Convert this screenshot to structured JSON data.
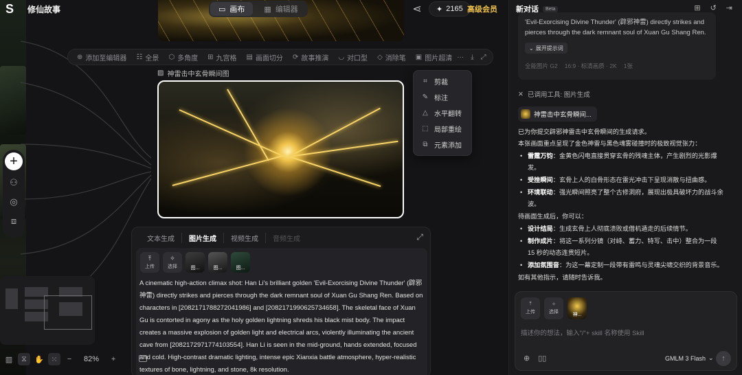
{
  "app": {
    "logo": "S",
    "project_title": "修仙故事"
  },
  "view_tabs": [
    {
      "label": "画布",
      "icon": "canvas-icon",
      "active": true
    },
    {
      "label": "编辑器",
      "icon": "editor-icon",
      "active": false
    }
  ],
  "topbar": {
    "credits": "2165",
    "vip_label": "高级会员"
  },
  "toolbar": [
    {
      "label": "添加至编辑器",
      "icon": "add-circle-icon"
    },
    {
      "label": "全景",
      "icon": "panorama-icon"
    },
    {
      "label": "多角度",
      "icon": "cube-icon"
    },
    {
      "label": "九宫格",
      "icon": "grid-icon"
    },
    {
      "label": "画面切分",
      "icon": "split-icon"
    },
    {
      "label": "故事推演",
      "icon": "story-icon"
    },
    {
      "label": "对口型",
      "icon": "lipsync-icon"
    },
    {
      "label": "消除笔",
      "icon": "eraser-icon"
    },
    {
      "label": "图片超清",
      "icon": "hd-icon"
    }
  ],
  "image_caption": "神雷击中玄骨瞬间图",
  "context_menu": [
    {
      "label": "剪裁",
      "icon": "crop-icon"
    },
    {
      "label": "标注",
      "icon": "annotate-icon"
    },
    {
      "label": "水平翻转",
      "icon": "flip-icon"
    },
    {
      "label": "局部重绘",
      "icon": "repaint-icon"
    },
    {
      "label": "元素添加",
      "icon": "element-add-icon"
    }
  ],
  "zoom": "82%",
  "gen_panel": {
    "tabs": [
      {
        "label": "文本生成",
        "state": "normal"
      },
      {
        "label": "图片生成",
        "state": "active"
      },
      {
        "label": "视频生成",
        "state": "normal"
      },
      {
        "label": "音频生成",
        "state": "disabled"
      }
    ],
    "upload_label": "上传",
    "select_label": "选择",
    "thumb_labels": [
      "图...",
      "图...",
      "图..."
    ],
    "prompt": "A cinematic high-action climax shot: Han Li's brilliant golden 'Evil-Exorcising Divine Thunder' (辟邪神雷) directly strikes and pierces through the dark remnant soul of Xuan Gu Shang Ren. Based on characters in [2082171788272041986] and [2082171990625734658]. The skeletal face of Xuan Gu is contorted in agony as the holy golden lightning shreds his black mist body. The impact creates a massive explosion of golden light and electrical arcs, violently illuminating the ancient cave from [2082172971774103554]. Han Li is seen in the mid-ground, hands extended, focused and cold. High-contrast dramatic lighting, intense epic Xianxia battle atmosphere, hyper-realistic textures of bone, lightning, and stone, 8k resolution."
  },
  "chat": {
    "title": "新对话",
    "beta": "Beta",
    "message_excerpt": "'Evil-Exorcising Divine Thunder' (辟邪神雷) directly strikes and pierces through the dark remnant soul of Xuan Gu Shang Ren. ...",
    "expand_prompt": "展开提示词",
    "options": [
      "全能图片 G2",
      "16:9 · 标清画质 · 2K",
      "1张"
    ],
    "tool_used_label": "已调用工具: 图片生成",
    "tool_chip": "神雷击中玄骨瞬间...",
    "reply_intro_1": "已为你提交辟邪神雷击中玄骨瞬间的生成请求。",
    "reply_intro_2": "本张画面重点呈现了金色神雷与黑色魂雾碰撞时的极致视觉张力：",
    "highlights": [
      {
        "title": "雷霆万钧",
        "text": "金黄色闪电直接贯穿玄骨的残魂主体，产生剧烈的光影爆发。"
      },
      {
        "title": "受挫瞬间",
        "text": "玄骨上人的白骨形态在雷光冲击下呈现消散与扭曲感。"
      },
      {
        "title": "环境联动",
        "text": "强光瞬间照亮了整个古修洞府，展现出极具破坏力的战斗余波。"
      }
    ],
    "after_label": "待画面生成后，你可以：",
    "next_steps": [
      {
        "title": "设计结局",
        "text": "生成玄骨上人彻底溃败或借机遁走的后续情节。"
      },
      {
        "title": "制作成片",
        "text": "将这一系列分镜（对峙、蓄力、特写、击中）整合为一段 15 秒的动态连贯短片。"
      },
      {
        "title": "添加氛围音",
        "text": "为这一幕定制一段带有雷鸣与灵魂尖啸交织的背景音乐。"
      }
    ],
    "closing": "如有其他指示，请随时告诉我。"
  },
  "input": {
    "upload_label": "上传",
    "select_label": "选择",
    "thumb_label": "神...",
    "placeholder": "描述你的想法，输入\"/\"+ skill 名称使用 Skill",
    "model": "GMLM 3 Flash"
  }
}
